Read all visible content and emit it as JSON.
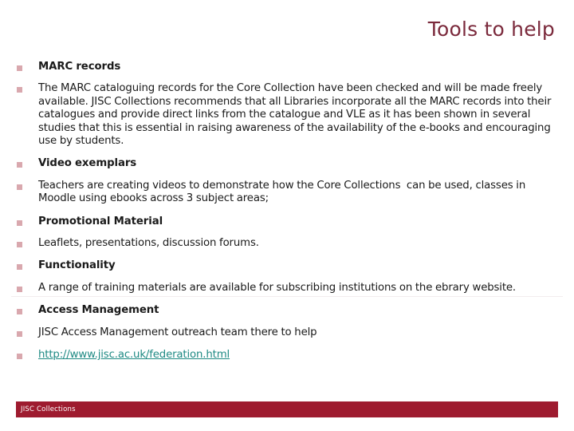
{
  "slide": {
    "title": "Tools to help",
    "title_color": "#7B2A3C",
    "bullet_color": "#D9A8AE",
    "link_color": "#1F8A84",
    "footer_color": "#9E1B2F",
    "body": [
      {
        "kind": "heading",
        "text": "MARC records"
      },
      {
        "kind": "para",
        "text": "The MARC cataloguing records for the Core Collection have been checked and will be made freely available. JISC Collections recommends that all Libraries incorporate all the MARC records into their catalogues and provide direct links from the catalogue and VLE as it has been shown in several studies that this is essential in raising awareness of the availability of the e-books and encouraging use by students."
      },
      {
        "kind": "heading",
        "text": "Video exemplars"
      },
      {
        "kind": "para",
        "text": "Teachers are creating videos to demonstrate how the Core Collections  can be used, classes in Moodle using ebooks across 3 subject areas;"
      },
      {
        "kind": "heading",
        "text": "Promotional Material"
      },
      {
        "kind": "para",
        "text": "Leaflets, presentations, discussion forums."
      },
      {
        "kind": "heading",
        "text": "Functionality"
      },
      {
        "kind": "para",
        "text": "A range of training materials are available for subscribing institutions on the ebrary website."
      },
      {
        "kind": "heading",
        "text": "Access Management"
      },
      {
        "kind": "para",
        "text": "JISC Access Management outreach team there to help"
      },
      {
        "kind": "link",
        "text": "http://www.jisc.ac.uk/federation.html"
      }
    ]
  },
  "footer": {
    "label": "JISC Collections"
  }
}
